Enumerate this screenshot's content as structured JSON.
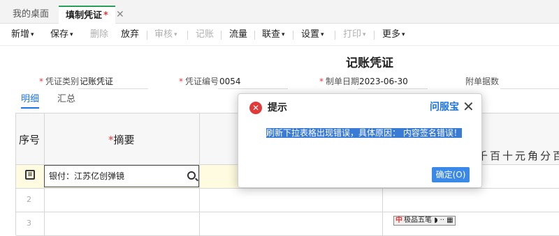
{
  "tabs": {
    "home": "我的桌面",
    "active": "填制凭证",
    "active_marker": "*",
    "close": "✕"
  },
  "toolbar": {
    "new": "新增",
    "save": "保存",
    "delete": "删除",
    "abandon": "放弃",
    "review": "审核",
    "post": "记账",
    "cashflow": "流量",
    "linked_query": "联查",
    "settings": "设置",
    "print": "打印",
    "more": "更多",
    "caret": "▾"
  },
  "voucher": {
    "title": "记账凭证",
    "type_label": "凭证类别",
    "type_value": "记账凭证",
    "number_label": "凭证编号",
    "number_value": "0054",
    "date_label": "制单日期",
    "date_value": "2023-06-30",
    "attachments_label": "附单据数",
    "required_mark": "*"
  },
  "subtabs": {
    "detail": "明细",
    "summary": "汇总"
  },
  "grid": {
    "col_seq": "序号",
    "col_summary_required": "*",
    "col_summary": "摘要",
    "amount_digits": "千百十元角分百",
    "rows": [
      {
        "num": "",
        "summary": "银付：江苏亿创弹镜"
      },
      {
        "num": "2",
        "summary": ""
      },
      {
        "num": "3",
        "summary": ""
      }
    ]
  },
  "ime": {
    "logo": "中",
    "name": "极品五笔",
    "extras": "◗ ·· ▦"
  },
  "dialog": {
    "title": "提示",
    "link": "问服宝",
    "message": "刷新下拉表格出现错误，具体原因：  内容签名错误！",
    "ok": "确定(O)",
    "close": "✕",
    "error_icon": "✕"
  },
  "colors": {
    "accent": "#1a73e8",
    "error": "#e03a3a",
    "active_tab_border": "#2a9d5a"
  }
}
